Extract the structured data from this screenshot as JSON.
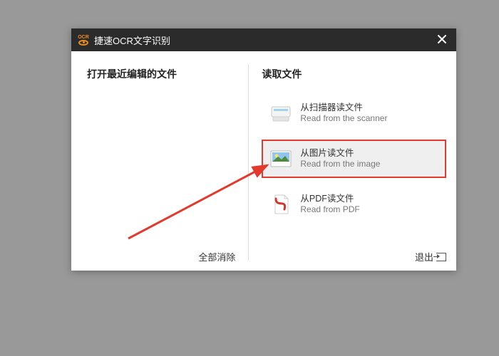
{
  "titlebar": {
    "logo_text": "OCR",
    "title": "捷速OCR文字识别"
  },
  "left": {
    "heading": "打开最近编辑的文件",
    "clear_all": "全部消除"
  },
  "right": {
    "heading": "读取文件",
    "options": [
      {
        "cn": "从扫描器读文件",
        "en": "Read from the scanner"
      },
      {
        "cn": "从图片读文件",
        "en": "Read from the image"
      },
      {
        "cn": "从PDF读文件",
        "en": "Read from PDF"
      }
    ],
    "exit": "退出"
  }
}
